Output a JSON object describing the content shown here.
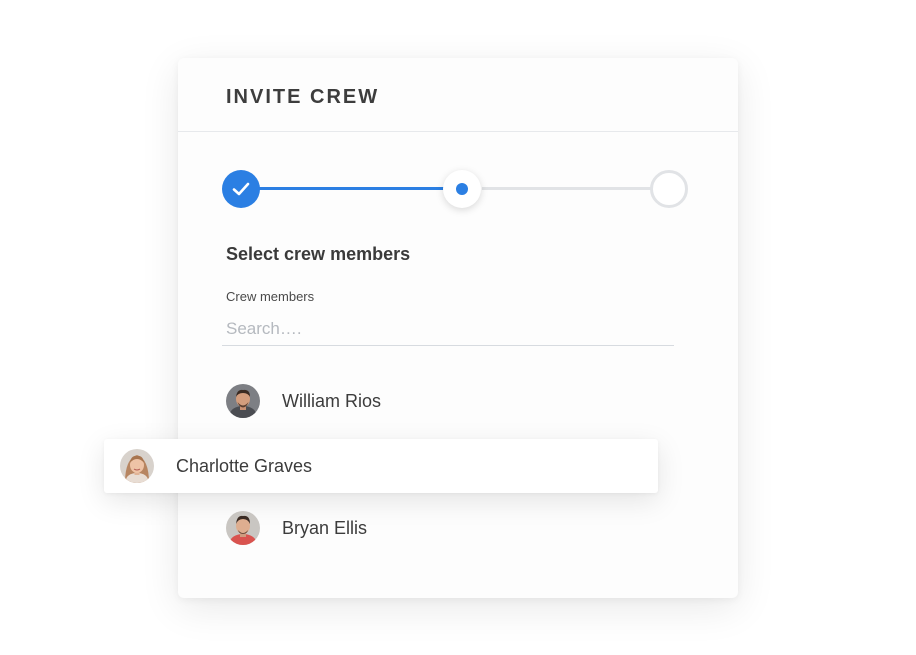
{
  "dialog": {
    "title": "INVITE CREW",
    "section_title": "Select crew members",
    "field_label": "Crew members",
    "search_placeholder": "Search…."
  },
  "stepper": {
    "steps": [
      {
        "state": "completed",
        "icon": "check-icon"
      },
      {
        "state": "current",
        "icon": "dot-icon"
      },
      {
        "state": "upcoming",
        "icon": ""
      }
    ],
    "accent_color": "#2b7fe3"
  },
  "members": [
    {
      "name": "William Rios",
      "icon": "avatar",
      "dragging": false
    },
    {
      "name": "Charlotte Graves",
      "icon": "avatar",
      "dragging": true
    },
    {
      "name": "Bryan Ellis",
      "icon": "avatar",
      "dragging": false
    }
  ]
}
